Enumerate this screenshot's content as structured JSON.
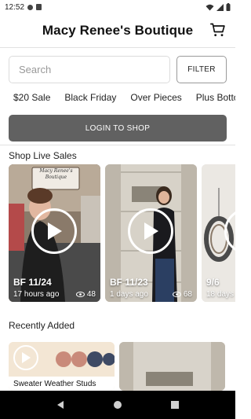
{
  "status": {
    "time": "12:52"
  },
  "header": {
    "title": "Macy Renee's Boutique"
  },
  "search": {
    "placeholder": "Search",
    "filter_label": "FILTER"
  },
  "chips": [
    "$20 Sale",
    "Black Friday",
    "Over Pieces",
    "Plus Botto"
  ],
  "login": {
    "label": "LOGIN TO SHOP"
  },
  "live": {
    "title": "Shop Live Sales",
    "cards": [
      {
        "label": "BF 11/24",
        "time": "17 hours ago",
        "views": "48"
      },
      {
        "label": "BF 11/23",
        "time": "1 days ago",
        "views": "68"
      },
      {
        "label": "9/6",
        "time": "18 days"
      }
    ],
    "sign_text": "Macy Renee's Boutique"
  },
  "recent": {
    "title": "Recently Added",
    "cards": [
      {
        "label": "Sweater Weather Studs"
      }
    ]
  },
  "colors": {
    "login_bg": "#616161",
    "nav_bg": "#000000"
  }
}
